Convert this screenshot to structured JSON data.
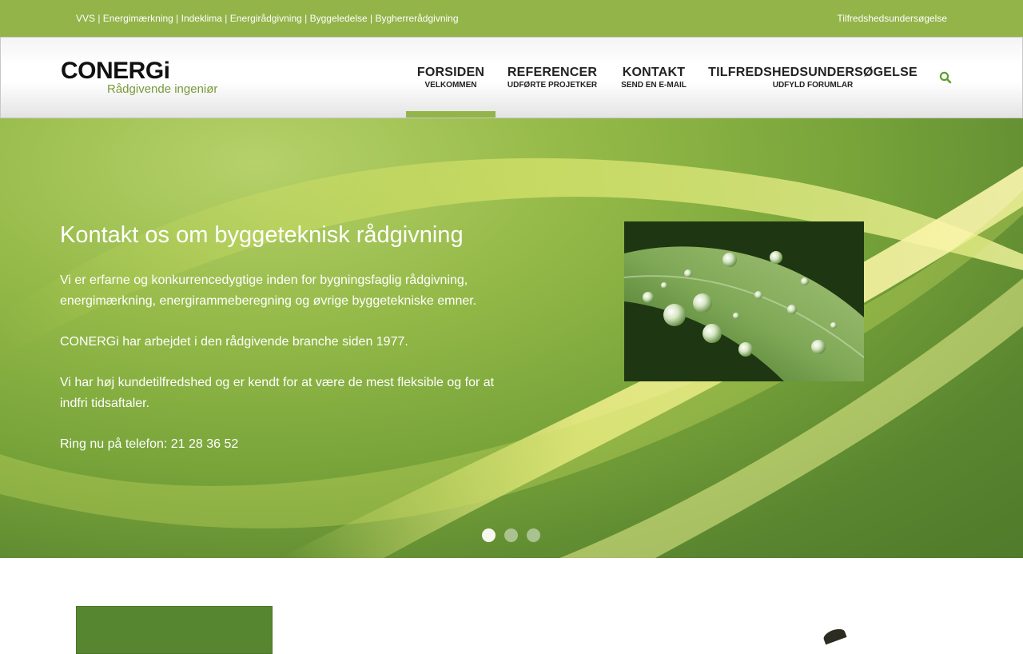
{
  "topbar": {
    "services": "VVS | Energimærkning | Indeklima | Energirådgivning | Byggeledelse | Bygherrerådgivning",
    "survey_link": "Tilfredshedsundersøgelse"
  },
  "logo": {
    "wordmark": "CONERGi",
    "tagline": "Rådgivende ingeniør"
  },
  "nav": {
    "items": [
      {
        "label": "FORSIDEN",
        "sub": "VELKOMMEN"
      },
      {
        "label": "REFERENCER",
        "sub": "UDFØRTE PROJETKER"
      },
      {
        "label": "KONTAKT",
        "sub": "SEND EN E-MAIL"
      },
      {
        "label": "TILFREDSHEDSUNDERSØGELSE",
        "sub": "UDFYLD FORUMLAR"
      }
    ],
    "search_icon": "search-icon"
  },
  "hero": {
    "title": "Kontakt os om byggeteknisk rådgivning",
    "paragraphs": [
      "Vi er erfarne og konkurrencedygtige inden for bygningsfaglig rådgivning, energimærkning, energirammeberegning og øvrige byggetekniske emner.",
      "CONERGi har arbejdet i den rådgivende branche siden 1977.",
      "Vi har høj kundetilfredshed og er kendt for at være de mest fleksible og for at indfri tidsaftaler.",
      "Ring nu på telefon: 21 28 36 52"
    ],
    "slides": {
      "count": 3,
      "active": 1
    }
  },
  "colors": {
    "accent": "#93b449",
    "hero_green": "#78a43a",
    "box_green": "#56862f",
    "search_icon": "#5aa02c"
  }
}
